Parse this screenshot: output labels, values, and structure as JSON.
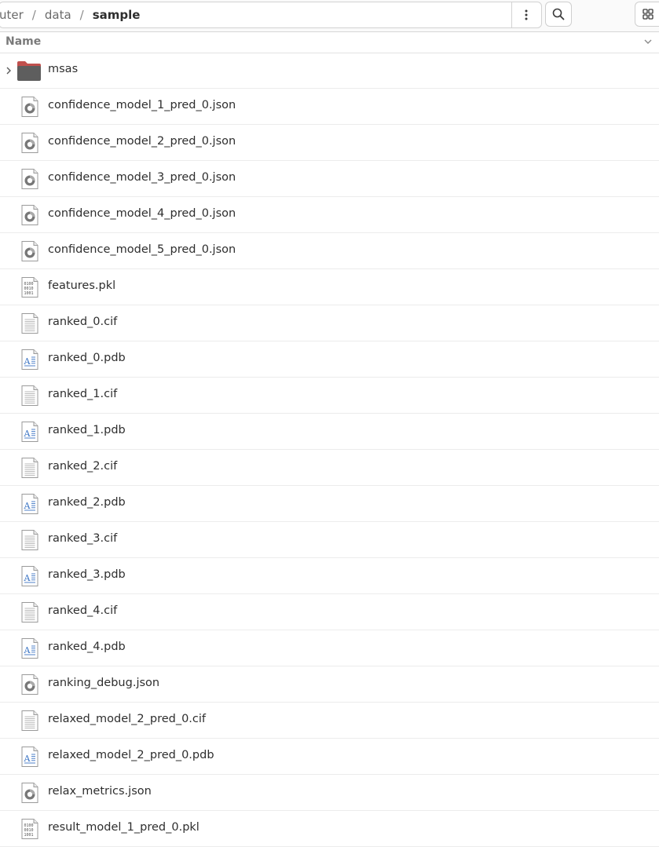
{
  "breadcrumb": {
    "items": [
      "uter",
      "data",
      "sample"
    ]
  },
  "column_header": {
    "name_label": "Name"
  },
  "files": [
    {
      "name": "msas",
      "type": "folder"
    },
    {
      "name": "confidence_model_1_pred_0.json",
      "type": "json"
    },
    {
      "name": "confidence_model_2_pred_0.json",
      "type": "json"
    },
    {
      "name": "confidence_model_3_pred_0.json",
      "type": "json"
    },
    {
      "name": "confidence_model_4_pred_0.json",
      "type": "json"
    },
    {
      "name": "confidence_model_5_pred_0.json",
      "type": "json"
    },
    {
      "name": "features.pkl",
      "type": "binary"
    },
    {
      "name": "ranked_0.cif",
      "type": "text"
    },
    {
      "name": "ranked_0.pdb",
      "type": "document"
    },
    {
      "name": "ranked_1.cif",
      "type": "text"
    },
    {
      "name": "ranked_1.pdb",
      "type": "document"
    },
    {
      "name": "ranked_2.cif",
      "type": "text"
    },
    {
      "name": "ranked_2.pdb",
      "type": "document"
    },
    {
      "name": "ranked_3.cif",
      "type": "text"
    },
    {
      "name": "ranked_3.pdb",
      "type": "document"
    },
    {
      "name": "ranked_4.cif",
      "type": "text"
    },
    {
      "name": "ranked_4.pdb",
      "type": "document"
    },
    {
      "name": "ranking_debug.json",
      "type": "json"
    },
    {
      "name": "relaxed_model_2_pred_0.cif",
      "type": "text"
    },
    {
      "name": "relaxed_model_2_pred_0.pdb",
      "type": "document"
    },
    {
      "name": "relax_metrics.json",
      "type": "json"
    },
    {
      "name": "result_model_1_pred_0.pkl",
      "type": "binary"
    }
  ],
  "icons": {
    "folder": "folder-icon",
    "json": "json-file-icon",
    "binary": "binary-file-icon",
    "text": "text-file-icon",
    "document": "document-file-icon",
    "menu": "vertical-dots-menu-icon",
    "search": "search-icon",
    "view": "grid-view-icon",
    "sort": "chevron-down-icon",
    "expander": "chevron-right-icon"
  },
  "colors": {
    "folder_top": "#c0504d",
    "folder_body": "#5e5e5e",
    "accent_blue": "#3b74c4"
  }
}
